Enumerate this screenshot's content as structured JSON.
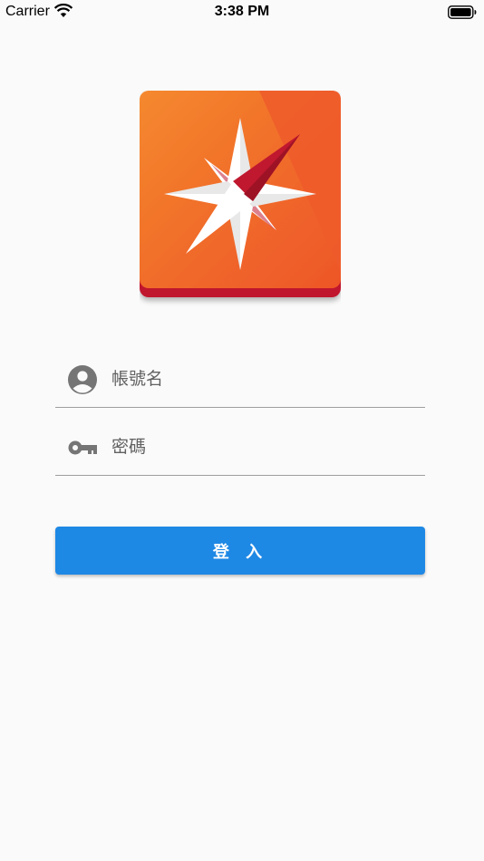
{
  "status_bar": {
    "carrier": "Carrier",
    "time": "3:38 PM",
    "wifi_icon": "wifi-icon",
    "battery_icon": "battery-icon"
  },
  "logo": {
    "icon": "compass-star-logo",
    "colors": {
      "orange": "#f0592a",
      "light_orange": "#f58a2e",
      "red": "#c0182f",
      "white": "#ffffff"
    }
  },
  "login_form": {
    "username": {
      "placeholder": "帳號名",
      "value": "",
      "icon": "account-circle-icon"
    },
    "password": {
      "placeholder": "密碼",
      "value": "",
      "icon": "key-icon"
    },
    "submit_label": "登 入"
  },
  "colors": {
    "background": "#fafafa",
    "button": "#1e88e5",
    "icon_gray": "#757575",
    "divider": "#9e9e9e"
  }
}
